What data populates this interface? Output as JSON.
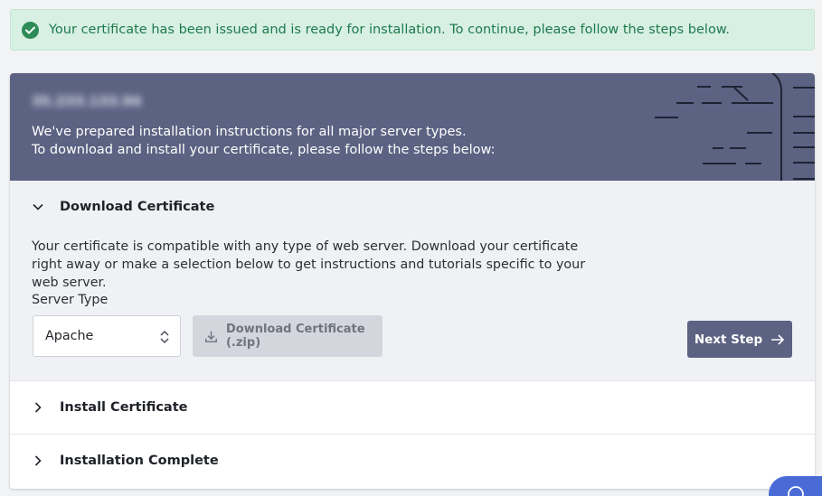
{
  "alert": {
    "message": "Your certificate has been issued and is ready for installation. To continue, please follow the steps below.",
    "icon": "check-circle-icon",
    "color": "#2e8b57"
  },
  "header": {
    "ip_address": "35.233.133.94",
    "line1": "We've prepared installation instructions for all major server types.",
    "line2": "To download and install your certificate, please follow the steps below:",
    "background": "#5b6282"
  },
  "steps": [
    {
      "title": "Download Certificate",
      "expanded": true
    },
    {
      "title": "Install Certificate",
      "expanded": false
    },
    {
      "title": "Installation Complete",
      "expanded": false
    }
  ],
  "download": {
    "description": "Your certificate is compatible with any type of web server. Download your certificate right away or make a selection below to get instructions and tutorials specific to your web server.",
    "server_type_label": "Server Type",
    "server_type_value": "Apache",
    "download_button": "Download Certificate (.zip)",
    "next_button": "Next Step"
  },
  "help_widget": {
    "icon": "help-icon",
    "color": "#4a6bd6"
  }
}
